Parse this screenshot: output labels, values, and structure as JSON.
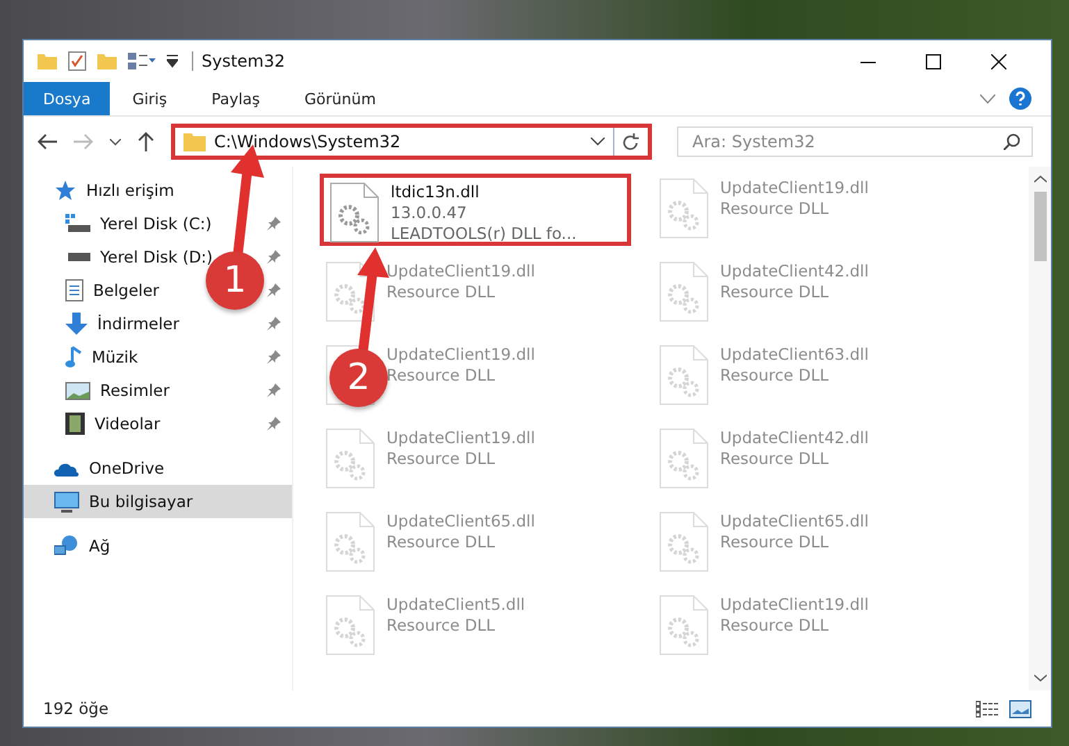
{
  "window": {
    "title": "System32"
  },
  "ribbon_tabs": [
    {
      "label": "Dosya",
      "selected": true
    },
    {
      "label": "Giriş",
      "selected": false
    },
    {
      "label": "Paylaş",
      "selected": false
    },
    {
      "label": "Görünüm",
      "selected": false
    }
  ],
  "address_bar": {
    "path": "C:\\Windows\\System32",
    "highlighted": true
  },
  "search": {
    "placeholder": "Ara: System32"
  },
  "sidebar": {
    "items": [
      {
        "label": "Hızlı erişim",
        "kind": "star",
        "selected": false,
        "children": [
          {
            "label": "Yerel Disk (C:)",
            "kind": "drive-c",
            "pinned": true
          },
          {
            "label": "Yerel Disk (D:)",
            "kind": "drive",
            "pinned": true
          },
          {
            "label": "Belgeler",
            "kind": "document",
            "pinned": true
          },
          {
            "label": "İndirmeler",
            "kind": "download",
            "pinned": true
          },
          {
            "label": "Müzik",
            "kind": "music",
            "pinned": true
          },
          {
            "label": "Resimler",
            "kind": "picture",
            "pinned": true
          },
          {
            "label": "Videolar",
            "kind": "video",
            "pinned": true
          }
        ]
      },
      {
        "label": "OneDrive",
        "kind": "cloud",
        "selected": false
      },
      {
        "label": "Bu bilgisayar",
        "kind": "computer",
        "selected": true
      },
      {
        "label": "Ağ",
        "kind": "network",
        "selected": false
      }
    ]
  },
  "files": [
    {
      "name": "ltdic13n.dll",
      "version": "13.0.0.47",
      "description": "LEADTOOLS(r) DLL fo...",
      "highlighted": true,
      "faded": false
    },
    {
      "name": "UpdateClient19.dll",
      "description": "Resource DLL",
      "highlighted": false,
      "faded": true
    },
    {
      "name": "UpdateClient19.dll",
      "description": "Resource DLL",
      "highlighted": false,
      "faded": true
    },
    {
      "name": "UpdateClient42.dll",
      "description": "Resource DLL",
      "highlighted": false,
      "faded": true
    },
    {
      "name": "UpdateClient19.dll",
      "description": "Resource DLL",
      "highlighted": false,
      "faded": true
    },
    {
      "name": "UpdateClient63.dll",
      "description": "Resource DLL",
      "highlighted": false,
      "faded": true
    },
    {
      "name": "UpdateClient19.dll",
      "description": "Resource DLL",
      "highlighted": false,
      "faded": true
    },
    {
      "name": "UpdateClient42.dll",
      "description": "Resource DLL",
      "highlighted": false,
      "faded": true
    },
    {
      "name": "UpdateClient65.dll",
      "description": "Resource DLL",
      "highlighted": false,
      "faded": true
    },
    {
      "name": "UpdateClient65.dll",
      "description": "Resource DLL",
      "highlighted": false,
      "faded": true
    },
    {
      "name": "UpdateClient5.dll",
      "description": "Resource DLL",
      "highlighted": false,
      "faded": true
    },
    {
      "name": "UpdateClient19.dll",
      "description": "Resource DLL",
      "highlighted": false,
      "faded": true
    }
  ],
  "status_bar": {
    "item_count": "192 öğe"
  },
  "annotations": [
    {
      "number": "1"
    },
    {
      "number": "2"
    }
  ]
}
